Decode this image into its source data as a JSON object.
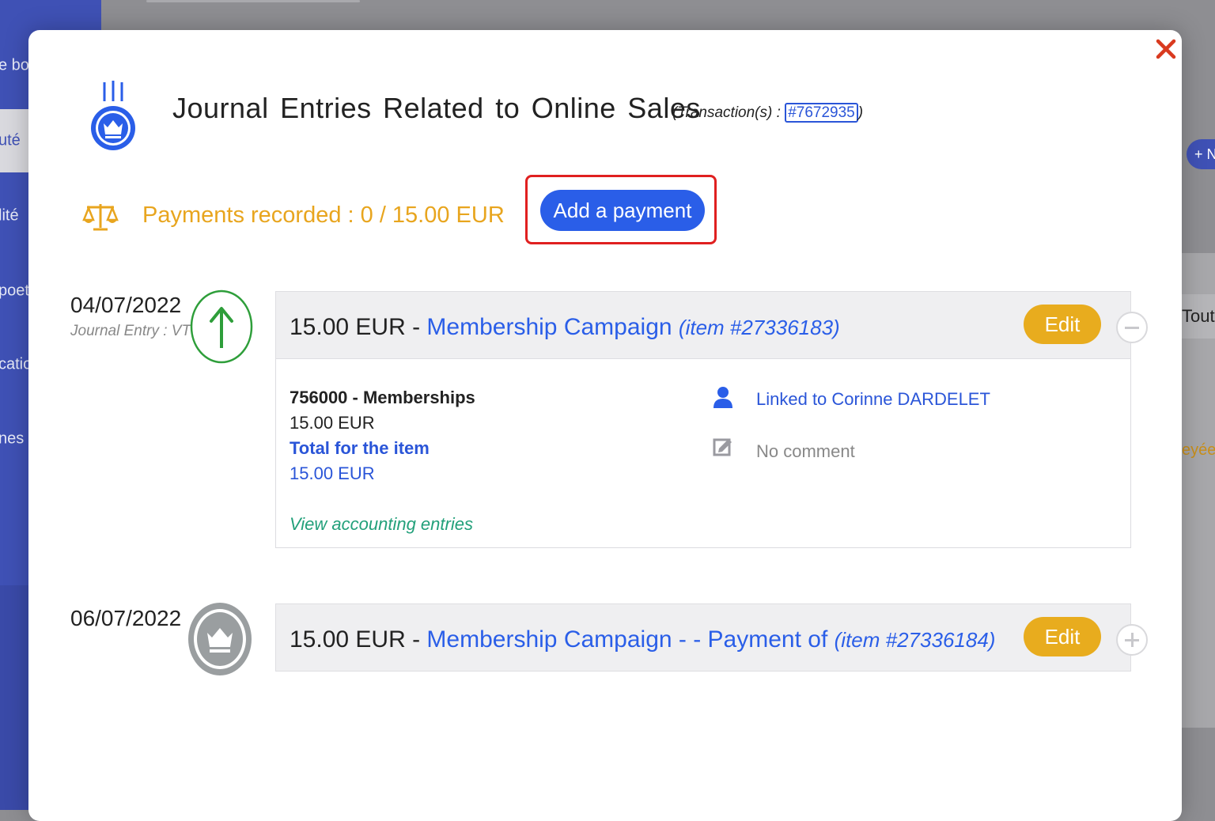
{
  "background": {
    "sidebar_items": [
      "e bor",
      "uté",
      "lité",
      "poet",
      "catio",
      "nes"
    ],
    "right_button": "+ N",
    "right_tab": "Tout",
    "right_note": "eyée."
  },
  "modal": {
    "close_icon": "close-x-icon",
    "title": "Journal Entries Related to Online Sales",
    "transaction_prefix": "(Transaction(s) : ",
    "transaction_id": "#7672935",
    "transaction_suffix": ")",
    "payments_recorded": "Payments recorded : 0 / 15.00 EUR",
    "add_payment_label": "Add a payment"
  },
  "entries": [
    {
      "date": "04/07/2022",
      "journal_entry": "Journal Entry : VT",
      "amount": "15.00 EUR",
      "separator": " - ",
      "campaign": "Membership Campaign",
      "item": "(item #27336183)",
      "edit_label": "Edit",
      "expanded": true,
      "details": {
        "account": "756000 - Memberships",
        "account_amount": "15.00 EUR",
        "total_label": "Total for the item",
        "total_amount": "15.00 EUR",
        "view_accounting": "View accounting entries",
        "linked_to": "Linked to Corinne DARDELET",
        "comment": "No comment"
      }
    },
    {
      "date": "06/07/2022",
      "amount": "15.00 EUR",
      "separator": " - ",
      "campaign": "Membership Campaign - - Payment of",
      "item": "(item #27336184)",
      "edit_label": "Edit",
      "expanded": false
    }
  ],
  "colors": {
    "accent_blue": "#2a5ee8",
    "payments_orange": "#e8a51e",
    "edit_yellow": "#e8ac1e",
    "highlight_red": "#e02020",
    "up_arrow_green": "#2e9e3a",
    "link_teal": "#22a07a"
  }
}
